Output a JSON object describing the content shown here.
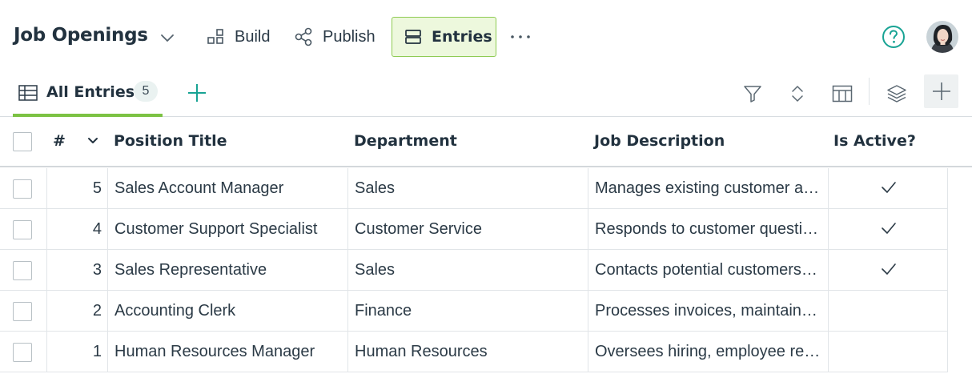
{
  "header": {
    "app_title": "Job Openings",
    "nav": [
      {
        "label": "Build",
        "icon": "build-icon"
      },
      {
        "label": "Publish",
        "icon": "share-icon"
      },
      {
        "label": "Entries",
        "icon": "entries-icon",
        "active": true
      }
    ],
    "more_icon": "more-horizontal-icon",
    "help_icon": "help-icon"
  },
  "tabs": {
    "active_tab_label": "All Entries",
    "active_tab_count": "5"
  },
  "table": {
    "columns": [
      "#",
      "Position Title",
      "Department",
      "Job Description",
      "Is Active?"
    ],
    "rows": [
      {
        "num": "5",
        "title": "Sales Account Manager",
        "department": "Sales",
        "description": "Manages existing customer accounts and builds relationships",
        "active": true
      },
      {
        "num": "4",
        "title": "Customer Support Specialist",
        "department": "Customer Service",
        "description": "Responds to customer questions and resolves issues",
        "active": true
      },
      {
        "num": "3",
        "title": "Sales Representative",
        "department": "Sales",
        "description": "Contacts potential customers and generates new sales",
        "active": true
      },
      {
        "num": "2",
        "title": "Accounting Clerk",
        "department": "Finance",
        "description": "Processes invoices, maintains financial records",
        "active": false
      },
      {
        "num": "1",
        "title": "Human Resources Manager",
        "department": "Human Resources",
        "description": "Oversees hiring, employee relations and benefits",
        "active": false
      }
    ]
  },
  "colors": {
    "accent_green": "#7cc243",
    "active_nav_bg": "#edf8dd",
    "active_nav_border": "#8ecb52",
    "help_teal": "#18a394",
    "text_dark": "#22323f"
  }
}
